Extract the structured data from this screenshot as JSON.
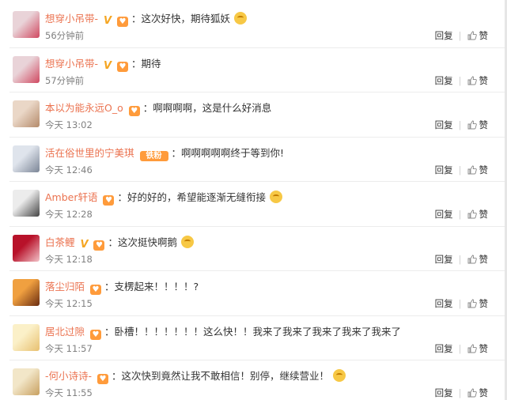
{
  "comments": [
    {
      "name": "想穿小吊带-",
      "v": true,
      "fan": true,
      "fan_label": "",
      "content": "：这次好快，期待狐妖",
      "emoji": "fox-emoji",
      "time": "56分钟前",
      "avatar": [
        "#e9d3d8",
        "#d04860"
      ]
    },
    {
      "name": "想穿小吊带-",
      "v": true,
      "fan": true,
      "fan_label": "",
      "content": "：期待",
      "emoji": "",
      "time": "57分钟前",
      "avatar": [
        "#e9d3d8",
        "#d04860"
      ]
    },
    {
      "name": "本以为能永远O_o",
      "v": false,
      "fan": true,
      "fan_label": "",
      "content": "：啊啊啊啊，这是什么好消息",
      "emoji": "",
      "time": "今天 13:02",
      "avatar": [
        "#ead7c7",
        "#b48a6a"
      ]
    },
    {
      "name": "活在俗世里的宁美琪",
      "v": false,
      "fan": true,
      "fan_label": "铁粉",
      "content": "：啊啊啊啊啊终于等到你!",
      "emoji": "",
      "time": "今天 12:46",
      "avatar": [
        "#dfe4ec",
        "#7b8596"
      ]
    },
    {
      "name": "Amber轩语",
      "v": false,
      "fan": true,
      "fan_label": "",
      "content": "：好的好的，希望能逐渐无缝衔接",
      "emoji": "smile-emoji",
      "time": "今天 12:28",
      "avatar": [
        "#ececec",
        "#444444"
      ]
    },
    {
      "name": "白茶鲤",
      "v": true,
      "fan": true,
      "fan_label": "",
      "content": "：这次挺快啊鹅",
      "emoji": "shock-emoji",
      "time": "今天 12:18",
      "avatar": [
        "#b8122a",
        "#f2c2c8"
      ]
    },
    {
      "name": "落尘归陌",
      "v": false,
      "fan": true,
      "fan_label": "",
      "content": "：支楞起来！！！！?",
      "emoji": "",
      "time": "今天 12:15",
      "avatar": [
        "#f0a040",
        "#6a2c10"
      ]
    },
    {
      "name": "居北过隙",
      "v": false,
      "fan": true,
      "fan_label": "",
      "content": "：卧槽！！！！！！！这么快！！我来了我来了我来了我来了我来了",
      "emoji": "",
      "time": "今天 11:57",
      "avatar": [
        "#fbf0c8",
        "#e8c070"
      ]
    },
    {
      "name": "-何小诗诗-",
      "v": false,
      "fan": true,
      "fan_label": "",
      "content": "：这次快到竟然让我不敢相信！别停，继续营业！",
      "emoji": "cry-emoji",
      "time": "今天 11:55",
      "avatar": [
        "#f2e6c8",
        "#c8a060"
      ]
    }
  ],
  "actions": {
    "reply": "回复",
    "like": "赞"
  }
}
